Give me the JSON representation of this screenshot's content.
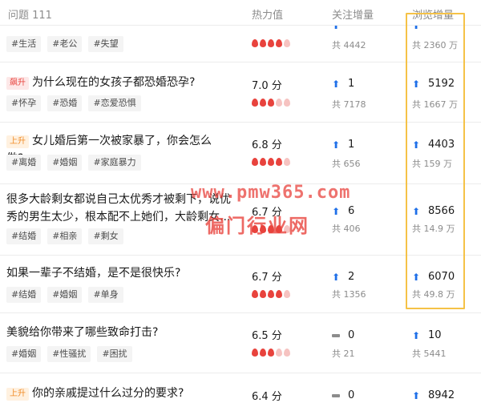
{
  "header": {
    "question": "问题 111",
    "heat": "热力值",
    "follow": "关注增量",
    "view": "浏览增量"
  },
  "rows": [
    {
      "badge": "",
      "title": "",
      "tags": [
        "#生活",
        "#老公",
        "#失望"
      ],
      "heat": "",
      "flames": [
        1,
        1,
        1,
        1,
        0
      ],
      "follow_delta": "",
      "follow_total": "共 4442",
      "view_delta": "",
      "view_total": "共 2360 万",
      "follow_icon": "up-arrow-icon",
      "view_icon": "up-arrow-icon"
    },
    {
      "badge": "飙升",
      "badge_color": "#e8433d",
      "title": "为什么现在的女孩子都恐婚恐孕?",
      "tags": [
        "#怀孕",
        "#恐婚",
        "#恋爱恐惧"
      ],
      "heat": "7.0 分",
      "flames": [
        1,
        1,
        1,
        0,
        0
      ],
      "follow_delta": "1",
      "follow_total": "共 7178",
      "view_delta": "5192",
      "view_total": "共 1667 万",
      "follow_icon": "up-arrow-icon",
      "view_icon": "up-arrow-icon"
    },
    {
      "badge": "上升",
      "badge_color": "#f08a24",
      "title": "女儿婚后第一次被家暴了，你会怎么做?",
      "tags": [
        "#离婚",
        "#婚姻",
        "#家庭暴力"
      ],
      "heat": "6.8 分",
      "flames": [
        1,
        1,
        1,
        1,
        0
      ],
      "follow_delta": "1",
      "follow_total": "共 656",
      "view_delta": "4403",
      "view_total": "共 159 万",
      "follow_icon": "up-arrow-icon",
      "view_icon": "up-arrow-icon"
    },
    {
      "badge": "",
      "title": "很多大龄剩女都说自己太优秀才被剩下，说优秀的男生太少，根本配不上她们，大龄剩女...",
      "tags": [
        "#结婚",
        "#相亲",
        "#剩女"
      ],
      "heat": "6.7 分",
      "flames": [
        1,
        1,
        1,
        1,
        0
      ],
      "follow_delta": "6",
      "follow_total": "共 406",
      "view_delta": "8566",
      "view_total": "共 14.9 万",
      "follow_icon": "up-arrow-icon",
      "view_icon": "up-arrow-icon"
    },
    {
      "badge": "",
      "title": "如果一辈子不结婚，是不是很快乐?",
      "tags": [
        "#结婚",
        "#婚姻",
        "#单身"
      ],
      "heat": "6.7 分",
      "flames": [
        1,
        1,
        1,
        1,
        0
      ],
      "follow_delta": "2",
      "follow_total": "共 1356",
      "view_delta": "6070",
      "view_total": "共 49.8 万",
      "follow_icon": "up-arrow-icon",
      "view_icon": "up-arrow-icon"
    },
    {
      "badge": "",
      "title": "美貌给你带来了哪些致命打击?",
      "tags": [
        "#婚姻",
        "#性骚扰",
        "#困扰"
      ],
      "heat": "6.5 分",
      "flames": [
        1,
        1,
        1,
        0,
        0
      ],
      "follow_delta": "0",
      "follow_total": "共 21",
      "view_delta": "10",
      "view_total": "共 5441",
      "follow_icon": "dash-icon",
      "view_icon": "up-arrow-icon"
    },
    {
      "badge": "上升",
      "badge_color": "#f08a24",
      "title": "你的亲戚提过什么过分的要求?",
      "tags": [],
      "heat": "6.4 分",
      "flames": [],
      "follow_delta": "0",
      "follow_total": "",
      "view_delta": "8942",
      "view_total": "",
      "follow_icon": "dash-icon",
      "view_icon": "up-arrow-icon"
    }
  ],
  "watermark": {
    "line1": "www.pmw365.com",
    "line2": "偏门行业网"
  },
  "colors": {
    "accent_blue": "#1e6fe8",
    "flame_red": "#e8433d",
    "highlight_border": "#f5c247"
  }
}
